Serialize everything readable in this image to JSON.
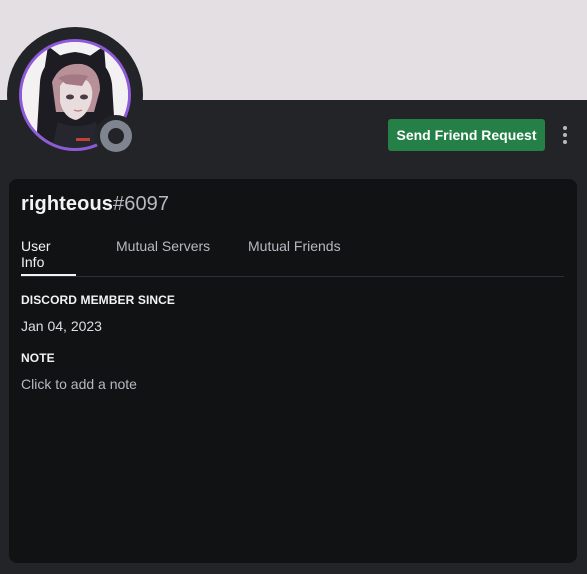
{
  "profile": {
    "username": "righteous",
    "discriminator": "#6097",
    "status": "offline"
  },
  "actions": {
    "send_friend_request_label": "Send Friend Request"
  },
  "tabs": [
    {
      "label": "User Info",
      "active": true
    },
    {
      "label": "Mutual Servers",
      "active": false
    },
    {
      "label": "Mutual Friends",
      "active": false
    }
  ],
  "user_info": {
    "member_since_title": "DISCORD MEMBER SINCE",
    "member_since_date": "Jan 04, 2023",
    "note_title": "NOTE",
    "note_placeholder": "Click to add a note"
  },
  "colors": {
    "banner": "#e4dfe2",
    "background": "#232428",
    "card": "#111214",
    "accent_green": "#248046",
    "avatar_ring": "#8d5ad9",
    "status_offline": "#80848e"
  }
}
